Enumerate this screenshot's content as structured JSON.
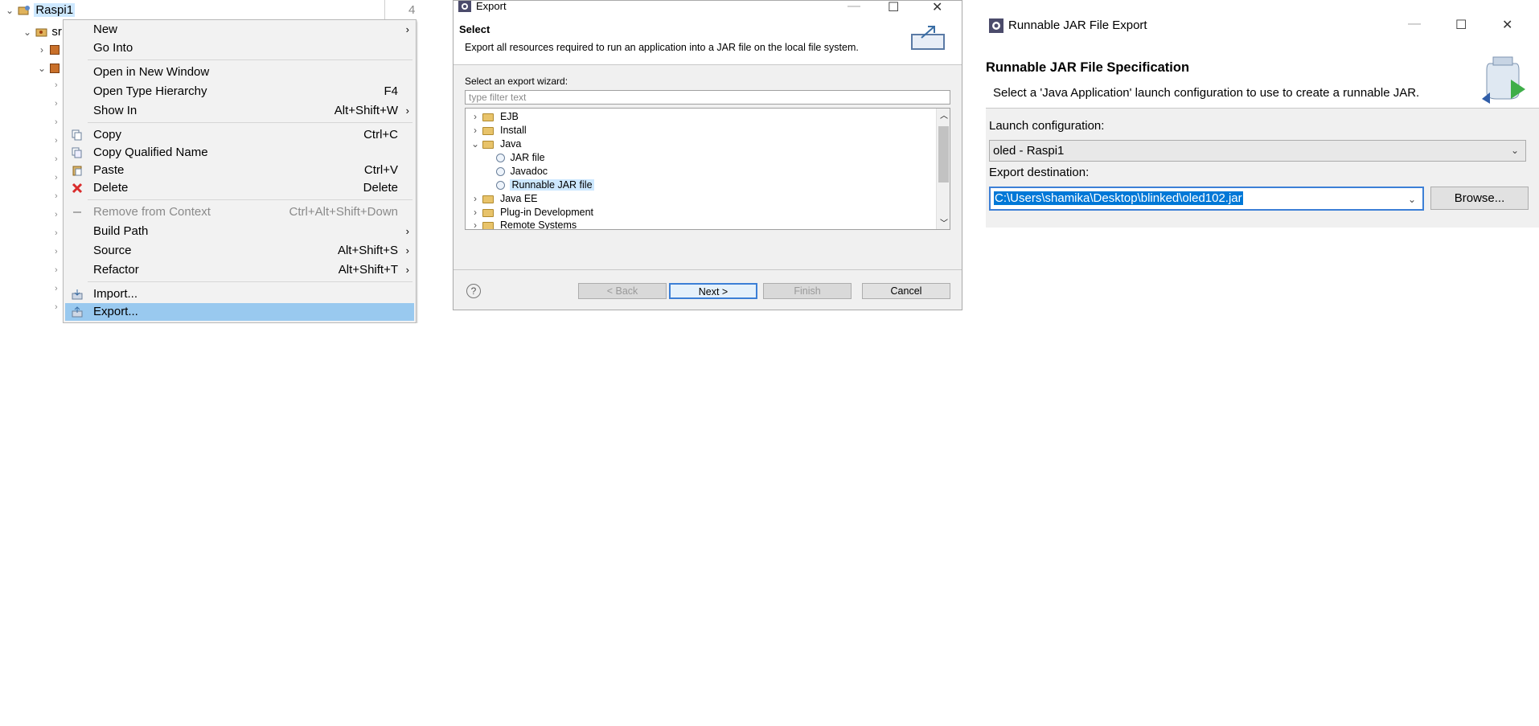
{
  "project_tree": {
    "project_name": "Raspi1",
    "src_label": "sr",
    "editor_line_number": "4"
  },
  "context_menu": {
    "items": [
      {
        "label": "New",
        "shortcut": "",
        "submenu": true
      },
      {
        "label": "Go Into",
        "shortcut": "",
        "submenu": false
      },
      {
        "label": "Open in New Window",
        "shortcut": "",
        "submenu": false
      },
      {
        "label": "Open Type Hierarchy",
        "shortcut": "F4",
        "submenu": false
      },
      {
        "label": "Show In",
        "shortcut": "Alt+Shift+W",
        "submenu": true
      },
      {
        "label": "Copy",
        "shortcut": "Ctrl+C",
        "submenu": false
      },
      {
        "label": "Copy Qualified Name",
        "shortcut": "",
        "submenu": false
      },
      {
        "label": "Paste",
        "shortcut": "Ctrl+V",
        "submenu": false
      },
      {
        "label": "Delete",
        "shortcut": "Delete",
        "submenu": false
      },
      {
        "label": "Remove from Context",
        "shortcut": "Ctrl+Alt+Shift+Down",
        "submenu": false,
        "disabled": true
      },
      {
        "label": "Build Path",
        "shortcut": "",
        "submenu": true
      },
      {
        "label": "Source",
        "shortcut": "Alt+Shift+S",
        "submenu": true
      },
      {
        "label": "Refactor",
        "shortcut": "Alt+Shift+T",
        "submenu": true
      },
      {
        "label": "Import...",
        "shortcut": "",
        "submenu": false
      },
      {
        "label": "Export...",
        "shortcut": "",
        "submenu": false,
        "selected": true
      }
    ],
    "submenu_arrow": "›"
  },
  "export_dialog": {
    "title": "Export",
    "heading": "Select",
    "description": "Export all resources required to run an application into a JAR file on the local file system.",
    "wizard_label": "Select an export wizard:",
    "filter_placeholder": "type filter text",
    "tree": [
      {
        "label": "EJB",
        "expanded": false
      },
      {
        "label": "Install",
        "expanded": false
      },
      {
        "label": "Java",
        "expanded": true
      },
      {
        "label": "JAR file",
        "child": true
      },
      {
        "label": "Javadoc",
        "child": true
      },
      {
        "label": "Runnable JAR file",
        "child": true,
        "selected": true
      },
      {
        "label": "Java EE",
        "expanded": false
      },
      {
        "label": "Plug-in Development",
        "expanded": false
      },
      {
        "label": "Remote Systems",
        "expanded": false
      }
    ],
    "help_icon": "?",
    "buttons": {
      "back": "< Back",
      "next": "Next >",
      "finish": "Finish",
      "cancel": "Cancel"
    }
  },
  "jar_dialog": {
    "title": "Runnable JAR File Export",
    "heading": "Runnable JAR File Specification",
    "description": "Select a 'Java Application' launch configuration to use to create a runnable JAR.",
    "launch_config_label": "Launch configuration:",
    "launch_config_value": "oled - Raspi1",
    "export_dest_label": "Export destination:",
    "export_dest_value": "C:\\Users\\shamika\\Desktop\\blinked\\oled102.jar",
    "browse_label": "Browse..."
  },
  "window_controls": {
    "minimize": "—",
    "maximize": "☐",
    "close": "✕"
  },
  "colors": {
    "menu_selected": "#99c9ef",
    "selection_blue": "#0078d7",
    "default_button_border": "#3c7fd6"
  }
}
